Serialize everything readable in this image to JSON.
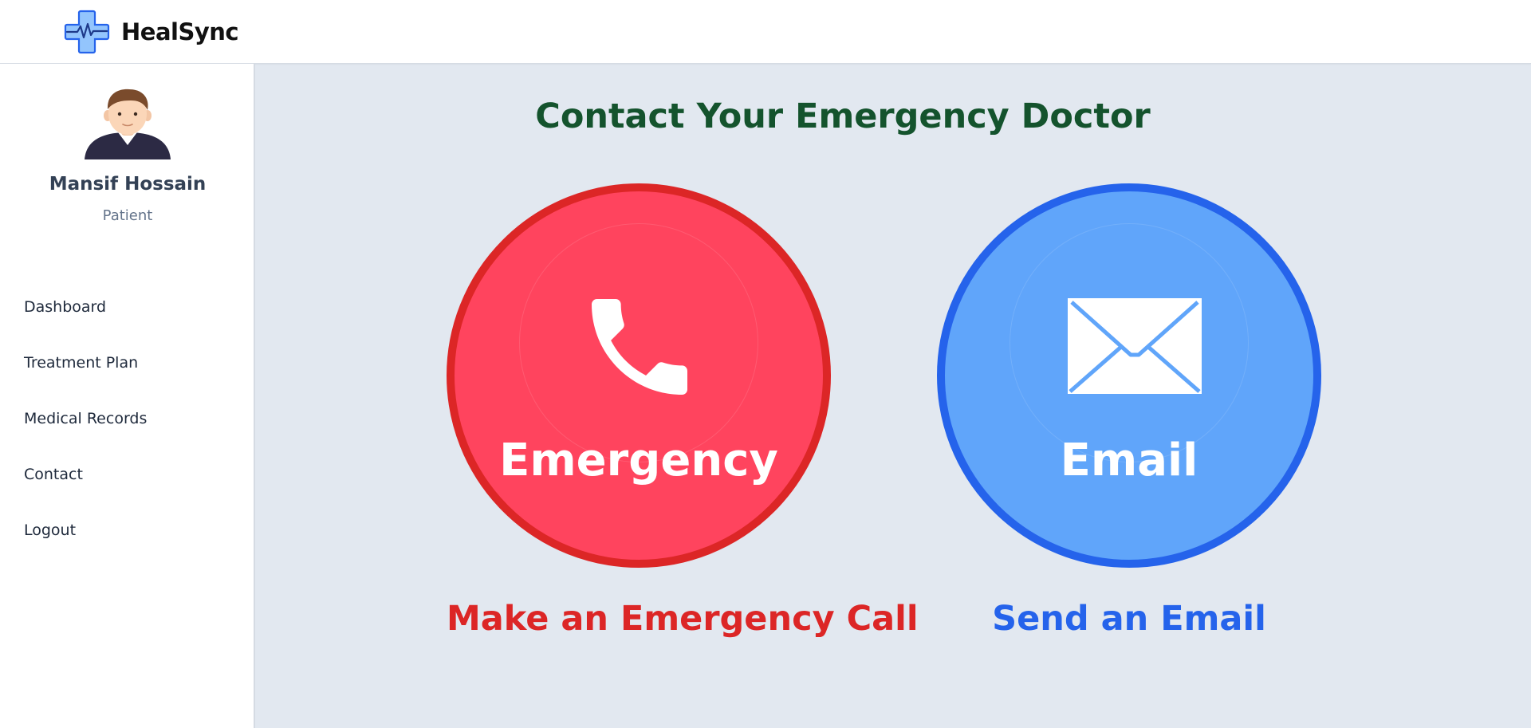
{
  "app": {
    "name": "HealSync",
    "logo_icon": "medical-cross-heartbeat-icon"
  },
  "user": {
    "name": "Mansif Hossain",
    "role": "Patient",
    "avatar_icon": "male-avatar-icon"
  },
  "sidebar": {
    "items": [
      {
        "label": "Dashboard"
      },
      {
        "label": "Treatment Plan"
      },
      {
        "label": "Medical Records"
      },
      {
        "label": "Contact"
      },
      {
        "label": "Logout"
      }
    ]
  },
  "main": {
    "title": "Contact Your Emergency Doctor",
    "emergency": {
      "label": "Emergency",
      "caption": "Make an Emergency Call",
      "icon": "phone-icon",
      "fill_color": "#ff445e",
      "accent_color": "#dc2626"
    },
    "email": {
      "label": "Email",
      "caption": "Send an Email",
      "icon": "envelope-icon",
      "fill_color": "#60a5fa",
      "accent_color": "#2563eb"
    }
  },
  "colors": {
    "title": "#14532d",
    "background": "#e2e8f0",
    "sidebar_background": "#ffffff"
  }
}
